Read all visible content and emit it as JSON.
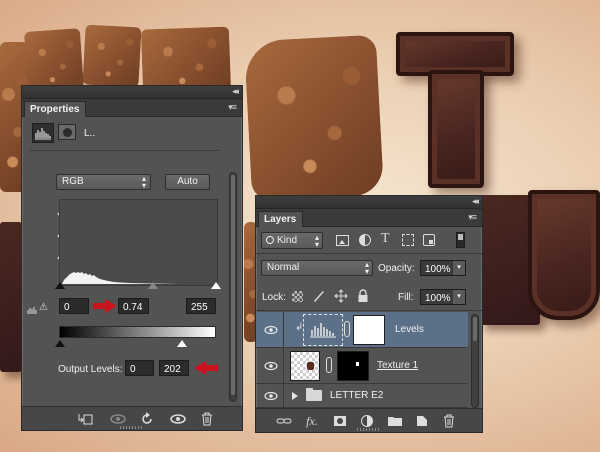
{
  "properties": {
    "tab_label": "Properties",
    "collapse_glyph": "◂◂",
    "menu_glyph": "▾≡",
    "layer_short_name": "L..",
    "channel_value": "RGB",
    "auto_label": "Auto",
    "input_black": "0",
    "input_gamma": "0.74",
    "input_white": "255",
    "output_label": "Output Levels:",
    "output_black": "0",
    "output_white": "202",
    "warning_glyph": "⚠"
  },
  "layers": {
    "tab_label": "Layers",
    "collapse_glyph": "◂◂",
    "menu_glyph": "▾≡",
    "filter_kind": "Kind",
    "blend_mode": "Normal",
    "opacity_label": "Opacity:",
    "opacity_value": "100%",
    "lock_label": "Lock:",
    "fill_label": "Fill:",
    "fill_value": "100%",
    "rows": [
      {
        "name": "Levels"
      },
      {
        "name": "Texture 1"
      },
      {
        "name": "LETTER E2"
      }
    ],
    "footer_fx": "fx."
  },
  "colors": {
    "panel_bg": "#535353",
    "selected_row": "#5c7087",
    "arrow_red": "#c8141c"
  }
}
